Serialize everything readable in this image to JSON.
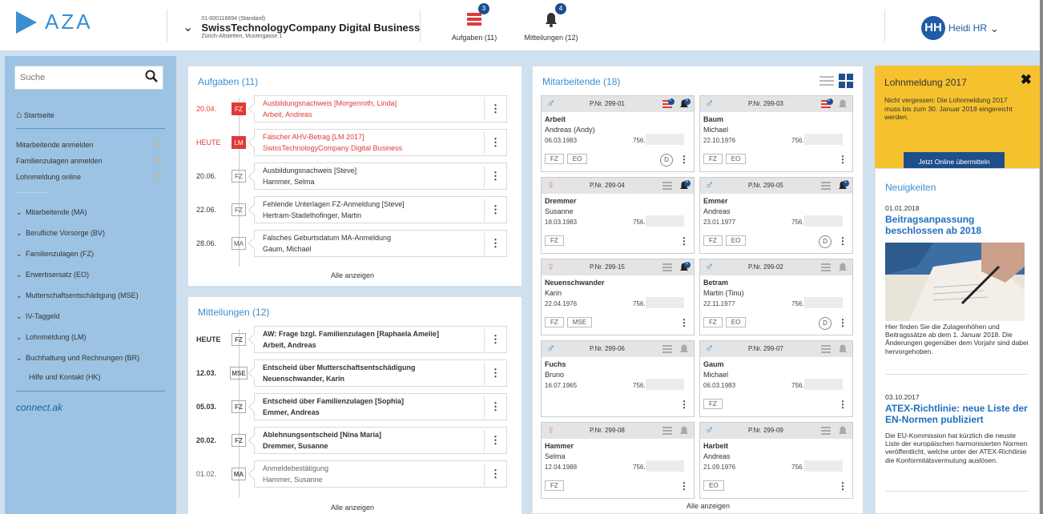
{
  "header": {
    "logo_text": "AZA",
    "company_id": "01-000116694 (Standard)",
    "company_name": "SwissTechnologyCompany Digital Business",
    "company_address": "Zürich-Altstetten, Mustergasse 1",
    "tasks_label": "Aufgaben (11)",
    "tasks_badge": "3",
    "messages_label": "Mitteilungen (12)",
    "messages_badge": "4",
    "user_initials": "HH",
    "user_name": "Heidi HR"
  },
  "sidebar": {
    "search_placeholder": "Suche",
    "home": "Startseite",
    "quick_links": [
      "Mitarbeitende anmelden",
      "Familienzulagen anmelden",
      "Lohnmeldung online"
    ],
    "categories": [
      "Mitarbeitende (MA)",
      "Berufliche Vorsorge (BV)",
      "Familienzulagen (FZ)",
      "Erwerbsersatz (EO)",
      "Mutterschaftsentschädigung (MSE)",
      "IV-Taggeld",
      "Lohnmeldung (LM)",
      "Buchhaltung und Rechnungen (BR)"
    ],
    "help": "Hilfe und Kontakt (HK)",
    "brand": "connect.ak"
  },
  "tasks": {
    "title": "Aufgaben (11)",
    "show_all": "Alle anzeigen",
    "items": [
      {
        "date": "20.04.",
        "tag": "FZ",
        "line1": "Ausbildungsnachweis [Morgenroth, Linda]",
        "line2": "Arbeit, Andreas"
      },
      {
        "date": "HEUTE",
        "tag": "LM",
        "line1": "Falscher AHV-Betrag [LM 2017]",
        "line2": "SwissTechnologyCompany Digital Business"
      },
      {
        "date": "20.06.",
        "tag": "FZ",
        "line1": "Ausbildungsnachweis [Steve]",
        "line2": "Hammer, Selma"
      },
      {
        "date": "22.06.",
        "tag": "FZ",
        "line1": "Fehlende Unterlagen FZ-Anmeldung [Steve]",
        "line2": "Hertram-Stadelhofinger, Martin"
      },
      {
        "date": "28.06.",
        "tag": "MA",
        "line1": "Falsches Geburtsdatum MA-Anmeldung",
        "line2": "Gaum, Michael"
      }
    ]
  },
  "messages": {
    "title": "Mitteilungen (12)",
    "show_all": "Alle anzeigen",
    "items": [
      {
        "date": "HEUTE",
        "tag": "FZ",
        "line1": "AW: Frage bzgl. Familienzulagen [Raphaela Amelie]",
        "line2": "Arbeit, Andreas"
      },
      {
        "date": "12.03.",
        "tag": "MSE",
        "line1": "Entscheid über Mutterschaftsentschädigung",
        "line2": "Neuenschwander, Karin"
      },
      {
        "date": "05.03.",
        "tag": "FZ",
        "line1": "Entscheid über Familienzulagen [Sophia]",
        "line2": "Emmer, Andreas"
      },
      {
        "date": "20.02.",
        "tag": "FZ",
        "line1": "Ablehnungsentscheid [Nina Maria]",
        "line2": "Dremmer, Susanne"
      },
      {
        "date": "01.02.",
        "tag": "MA",
        "line1": "Anmeldebestätigung",
        "line2": "Hammer, Susanne"
      }
    ]
  },
  "employees": {
    "title": "Mitarbeitende (18)",
    "show_all": "Alle anzeigen",
    "items": [
      {
        "gender": "♂",
        "pnr": "P.Nr. 299-01",
        "last": "Arbeit",
        "first": "Andreas (Andy)",
        "dob": "06.03.1983",
        "ahv": "756.",
        "tags": [
          "FZ",
          "EO"
        ],
        "d": "D",
        "task_badge": "1",
        "msg_badge": "1"
      },
      {
        "gender": "♂",
        "pnr": "P.Nr. 299-03",
        "last": "Baum",
        "first": "Michael",
        "dob": "22.10.1976",
        "ahv": "756.",
        "tags": [
          "FZ",
          "EO"
        ],
        "d": "",
        "task_badge": "2",
        "msg_badge": ""
      },
      {
        "gender": "♀",
        "pnr": "P.Nr. 299-04",
        "last": "Dremmer",
        "first": "Susanne",
        "dob": "18.03.1983",
        "ahv": "756.",
        "tags": [
          "FZ"
        ],
        "d": "",
        "task_badge": "",
        "msg_badge": "1"
      },
      {
        "gender": "♂",
        "pnr": "P.Nr. 299-05",
        "last": "Emmer",
        "first": "Andreas",
        "dob": "23.01.1977",
        "ahv": "756.",
        "tags": [
          "FZ",
          "EO"
        ],
        "d": "D",
        "task_badge": "",
        "msg_badge": "1"
      },
      {
        "gender": "♀",
        "pnr": "P.Nr. 299-15",
        "last": "Neuenschwander",
        "first": "Karin",
        "dob": "22.04.1976",
        "ahv": "756.",
        "tags": [
          "FZ",
          "MSE"
        ],
        "d": "",
        "task_badge": "",
        "msg_badge": "1"
      },
      {
        "gender": "♂",
        "pnr": "P.Nr. 299-02",
        "last": "Betram",
        "first": "Martin (Tinu)",
        "dob": "22.11.1977",
        "ahv": "756.",
        "tags": [
          "FZ",
          "EO"
        ],
        "d": "D",
        "task_badge": "",
        "msg_badge": ""
      },
      {
        "gender": "♂",
        "pnr": "P.Nr. 299-06",
        "last": "Fuchs",
        "first": "Bruno",
        "dob": "16.07.1965",
        "ahv": "756.",
        "tags": [],
        "d": "",
        "task_badge": "",
        "msg_badge": ""
      },
      {
        "gender": "♂",
        "pnr": "P.Nr. 299-07",
        "last": "Gaum",
        "first": "Michael",
        "dob": "06.03.1983",
        "ahv": "756.",
        "tags": [
          "FZ"
        ],
        "d": "",
        "task_badge": "",
        "msg_badge": ""
      },
      {
        "gender": "♀",
        "pnr": "P.Nr. 299-08",
        "last": "Hammer",
        "first": "Selma",
        "dob": "12.04.1988",
        "ahv": "756.",
        "tags": [
          "FZ"
        ],
        "d": "",
        "task_badge": "",
        "msg_badge": ""
      },
      {
        "gender": "♂",
        "pnr": "P.Nr. 299-09",
        "last": "Harbeit",
        "first": "Andreas",
        "dob": "21.09.1976",
        "ahv": "756.",
        "tags": [
          "EO"
        ],
        "d": "",
        "task_badge": "",
        "msg_badge": ""
      }
    ]
  },
  "lohnmeldung": {
    "title": "Lohnmeldung 2017",
    "text": "Nicht vergessen: Die Lohnmeldung 2017 muss bis zum 30. Januar 2018 eingereicht werden.",
    "button": "Jetzt Online übermitteln"
  },
  "news": {
    "title": "Neuigkeiten",
    "items": [
      {
        "date": "01.01.2018",
        "headline": "Beitragsanpassung beschlossen ab 2018",
        "text": "Hier finden Sie die Zulagenhöhen und Beitragssätze ab dem 1. Januar 2018. Die Änderungen gegenüber dem Vorjahr sind dabei hervorgehoben."
      },
      {
        "date": "03.10.2017",
        "headline": "ATEX-Richtlinie: neue Liste der EN-Normen publiziert",
        "text": "Die EU-Kommission hat kürzlich die neuste Liste der europäischen harmonisierten Normen veröffentlicht, welche unter der ATEX-Richtlinie die Konformitätsvermutung auslösen."
      }
    ]
  },
  "colors": {
    "accent": "#3a8fd1",
    "alert": "#e03a3a",
    "warning_box": "#f5c22e",
    "navy": "#1f4e8c"
  }
}
